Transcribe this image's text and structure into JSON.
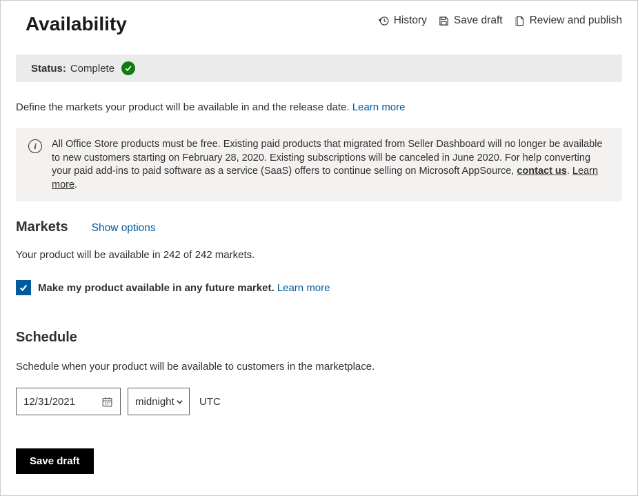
{
  "header": {
    "title": "Availability",
    "actions": {
      "history": "History",
      "saveDraft": "Save draft",
      "reviewPublish": "Review and publish"
    }
  },
  "status": {
    "label": "Status:",
    "value": "Complete"
  },
  "intro": {
    "text": "Define the markets your product will be available in and the release date. ",
    "learnMore": "Learn more"
  },
  "infoBox": {
    "iconGlyph": "i",
    "text": "All Office Store products must be free. Existing paid products that migrated from Seller Dashboard will no longer be available to new customers starting on February 28, 2020. Existing subscriptions will be canceled in June 2020. For help converting your paid add-ins to paid software as a service (SaaS) offers to continue selling on Microsoft AppSource, ",
    "contactUs": "contact us",
    "separator": ". ",
    "learnMore": "Learn more",
    "trailingDot": "."
  },
  "markets": {
    "title": "Markets",
    "showOptions": "Show options",
    "description": "Your product will be available in 242 of 242 markets.",
    "checkbox": {
      "checked": true,
      "label": "Make my product available in any future market. ",
      "learnMore": "Learn more"
    }
  },
  "schedule": {
    "title": "Schedule",
    "description": "Schedule when your product will be available to customers in the marketplace.",
    "date": "12/31/2021",
    "time": "midnight",
    "timezone": "UTC"
  },
  "footer": {
    "saveDraft": "Save draft"
  }
}
